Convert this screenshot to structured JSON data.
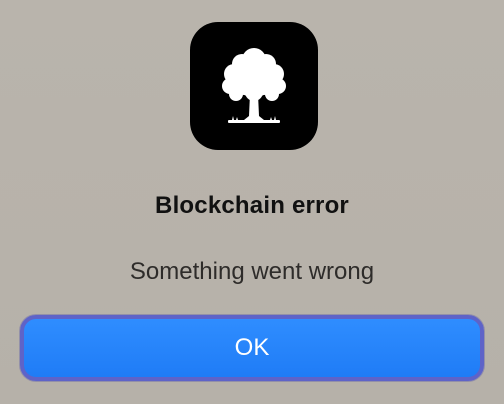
{
  "dialog": {
    "app_icon": "tree-icon",
    "title": "Blockchain error",
    "message": "Something went wrong",
    "ok_label": "OK"
  },
  "colors": {
    "background": "#b8b3ab",
    "icon_background": "#000000",
    "button": "#1f7cf6",
    "button_focus_ring": "#5e63c8"
  }
}
